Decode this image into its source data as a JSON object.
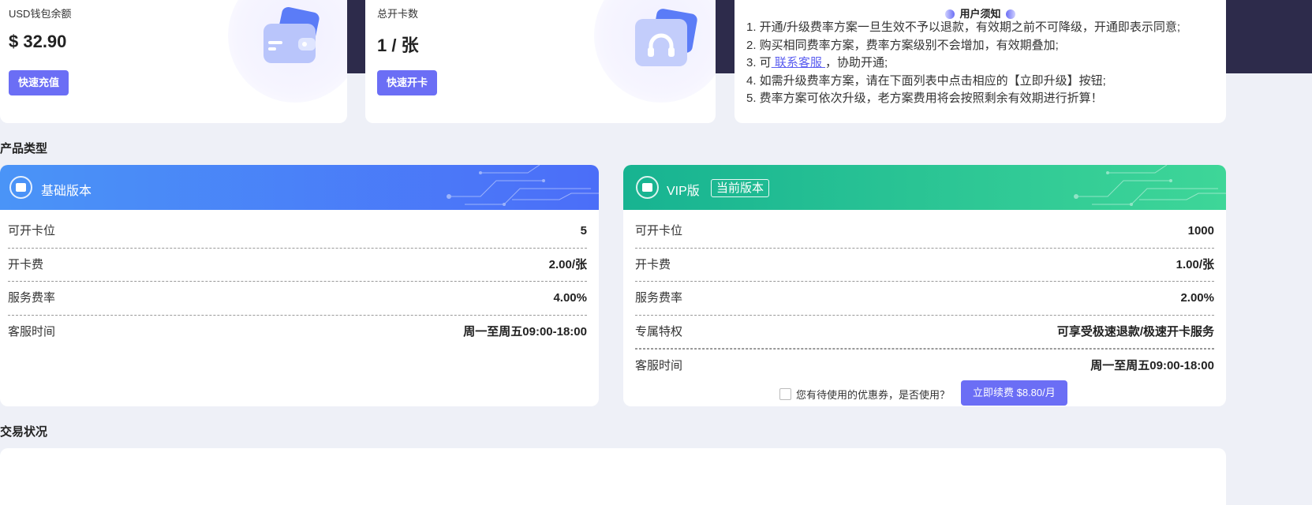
{
  "wallet": {
    "label": "USD钱包余额",
    "value": "$ 32.90",
    "button": "快速充值",
    "icon": "wallet-icon"
  },
  "cards": {
    "label": "总开卡数",
    "value": "1 / 张",
    "button": "快速开卡",
    "icon": "headset-icon"
  },
  "notice": {
    "title": "用户须知",
    "items": [
      "1. 开通/升级费率方案一旦生效不予以退款，有效期之前不可降级，开通即表示同意;",
      "2. 购买相同费率方案，费率方案级别不会增加，有效期叠加;",
      "4. 如需升级费率方案，请在下面列表中点击相应的【立即升级】按钮;",
      "5. 费率方案可依次升级，老方案费用将会按照剩余有效期进行折算！"
    ],
    "item3_prefix": "3. 可",
    "item3_link": " 联系客服 ",
    "item3_suffix": "，协助开通;"
  },
  "sections": {
    "product_type": "产品类型",
    "transaction_status": "交易状况"
  },
  "plans": {
    "basic": {
      "name": "基础版本",
      "rows": [
        {
          "k": "可开卡位",
          "v": "5"
        },
        {
          "k": "开卡费",
          "v": "2.00/张"
        },
        {
          "k": "服务费率",
          "v": "4.00%"
        },
        {
          "k": "客服时间",
          "v": "周一至周五09:00-18:00"
        }
      ]
    },
    "vip": {
      "name": "VIP版",
      "badge": "当前版本",
      "rows": [
        {
          "k": "可开卡位",
          "v": "1000"
        },
        {
          "k": "开卡费",
          "v": "1.00/张"
        },
        {
          "k": "服务费率",
          "v": "2.00%"
        },
        {
          "k": "专属特权",
          "v": "可享受极速退款/极速开卡服务"
        },
        {
          "k": "客服时间",
          "v": "周一至周五09:00-18:00"
        }
      ],
      "coupon_text": "您有待使用的优惠券，是否使用？",
      "renew_button": "立即续费 $8.80/月"
    }
  },
  "colors": {
    "accent": "#6b6ef5",
    "basic_header": "#4b7ef8",
    "vip_header": "#1fbf90",
    "background": "#eef0f7",
    "dark_band": "#2d2b4b"
  }
}
